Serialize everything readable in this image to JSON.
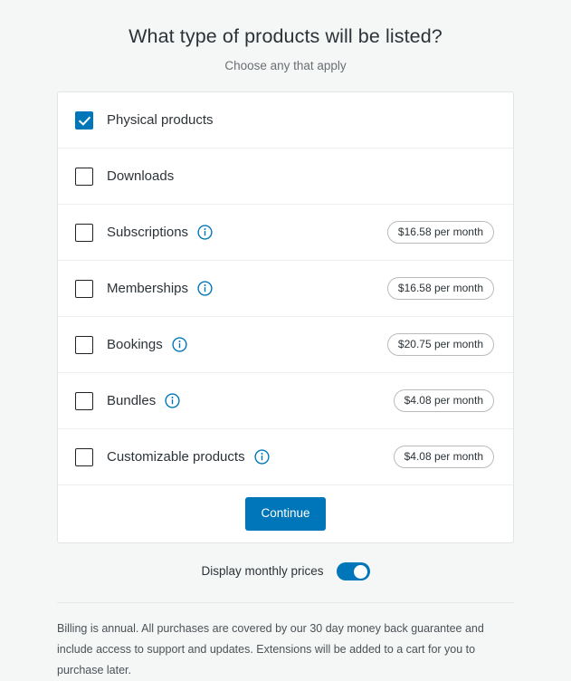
{
  "header": {
    "title": "What type of products will be listed?",
    "subtitle": "Choose any that apply"
  },
  "options": [
    {
      "label": "Physical products",
      "checked": true,
      "has_info": false,
      "price": ""
    },
    {
      "label": "Downloads",
      "checked": false,
      "has_info": false,
      "price": ""
    },
    {
      "label": "Subscriptions",
      "checked": false,
      "has_info": true,
      "price": "$16.58 per month"
    },
    {
      "label": "Memberships",
      "checked": false,
      "has_info": true,
      "price": "$16.58 per month"
    },
    {
      "label": "Bookings",
      "checked": false,
      "has_info": true,
      "price": "$20.75 per month"
    },
    {
      "label": "Bundles",
      "checked": false,
      "has_info": true,
      "price": "$4.08 per month"
    },
    {
      "label": "Customizable products",
      "checked": false,
      "has_info": true,
      "price": "$4.08 per month"
    }
  ],
  "continue_button": {
    "label": "Continue"
  },
  "toggle": {
    "label": "Display monthly prices",
    "on": true
  },
  "footer": {
    "note": "Billing is annual. All purchases are covered by our 30 day money back guarantee and include access to support and updates. Extensions will be added to a cart for you to purchase later."
  },
  "colors": {
    "accent": "#0076ba",
    "background": "#f5f6f6",
    "card": "#ffffff",
    "text": "#2c3338",
    "muted_text": "#6a6f74",
    "border": "#e2e4e7"
  },
  "icons": {
    "info": "info-circle-icon",
    "check": "check-icon"
  }
}
